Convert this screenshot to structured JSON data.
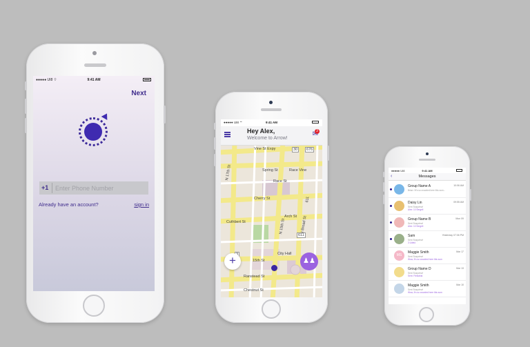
{
  "phone1": {
    "status": {
      "carrier": "●●●●● UI8 ⌔",
      "time": "9:41 AM"
    },
    "next_label": "Next",
    "country_code": "+1",
    "phone_placeholder": "Enter Phone Number",
    "account_text": "Already   have an account?",
    "signin_label": "sign in"
  },
  "phone2": {
    "status": {
      "carrier": "●●●●● UI8 ⌔",
      "time": "9:41 AM"
    },
    "greeting": "Hey Alex,",
    "subtitle": "Welcome to Arrow!",
    "notif_count": "3",
    "map_labels": {
      "vine": "Vine St Expy",
      "n30": "30",
      "n676": "676",
      "spring": "Spring St",
      "racevine": "Race Vine",
      "race": "Race St",
      "n17": "N 17th St",
      "cherry": "Cherry St",
      "n611": "611",
      "cuthbert": "Cuthbert St",
      "n15": "N 15th St",
      "arch": "Arch St",
      "nbroad": "N Broad St",
      "n611b": "611",
      "n3": "3",
      "n15th": "15th St",
      "cityhall": "City Hall",
      "ranstead": "Ranstead St",
      "chestnut": "Chestnut St"
    },
    "add_label": "+"
  },
  "phone3": {
    "status": {
      "carrier": "●●●●● UI8",
      "time": "9:41 AM"
    },
    "title": "Messages",
    "messages": [
      {
        "name": "Group Name A",
        "time": "10:06 AM",
        "preview": "Brian: Hi's so crowded here this sum...",
        "preview2": "",
        "unread": true,
        "color": "#79b7e8",
        "initials": ""
      },
      {
        "name": "Daisy Lin",
        "time": "09:55 AM",
        "preview": "Sent Snapview!",
        "preview2": "Alex: 10 Sergeli",
        "unread": true,
        "color": "#e8c070",
        "initials": ""
      },
      {
        "name": "Group Name B",
        "time": "Mon 09",
        "preview": "Sent Snapview!",
        "preview2": "Alex: 10 Sergeli",
        "unread": true,
        "color": "#f0b8b8",
        "initials": ""
      },
      {
        "name": "Sam",
        "time": "Yesterday 07:06 PM",
        "preview": "Sent Snapview!",
        "preview2": "3 Udeid",
        "unread": true,
        "color": "#9ab08a",
        "initials": ""
      },
      {
        "name": "Maggie Smith",
        "time": "Mar 17",
        "preview": "Sent Snapview!",
        "preview2": "Wow, It's so crowded here this sum",
        "unread": false,
        "color": "#f5b8c8",
        "initials": "MS"
      },
      {
        "name": "Group Name D",
        "time": "Mar 13",
        "preview": "Sent Snapview!",
        "preview2": "Sent: Flestahal",
        "unread": false,
        "color": "#f2dc8c",
        "initials": ""
      },
      {
        "name": "Maggie Smith",
        "time": "Mar 10",
        "preview": "Sent Snapview!",
        "preview2": "Wow, It's so crowded here this sum",
        "unread": false,
        "color": "#c4d6e8",
        "initials": ""
      }
    ]
  }
}
